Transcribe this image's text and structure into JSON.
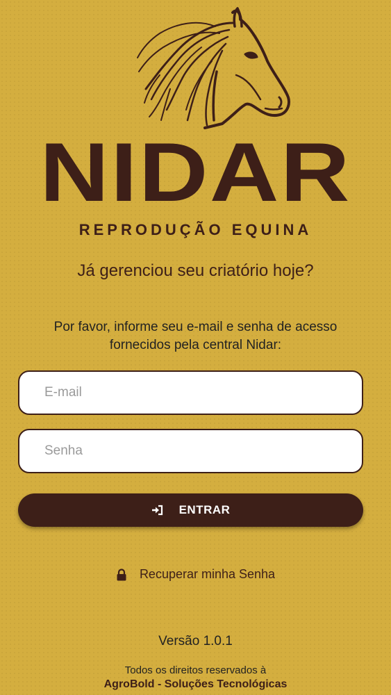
{
  "brand": {
    "name": "NIDAR",
    "subtitle": "REPRODUÇÃO EQUINA",
    "logo_icon": "horse-head-icon"
  },
  "headline": "Já gerenciou seu criatório hoje?",
  "instructions": "Por favor, informe seu e-mail e senha de acesso fornecidos pela central Nidar:",
  "form": {
    "email": {
      "placeholder": "E-mail",
      "value": ""
    },
    "password": {
      "placeholder": "Senha",
      "value": ""
    },
    "submit": {
      "label": "ENTRAR",
      "icon": "sign-in-icon"
    }
  },
  "recover": {
    "label": "Recuperar minha Senha",
    "icon": "lock-icon"
  },
  "footer": {
    "version": "Versão 1.0.1",
    "rights": "Todos os direitos reservados à",
    "company": "AgroBold - Soluções Tecnológicas"
  },
  "colors": {
    "background": "#d4ae3f",
    "brand_brown": "#3d1f18",
    "field_bg": "#ffffff"
  }
}
